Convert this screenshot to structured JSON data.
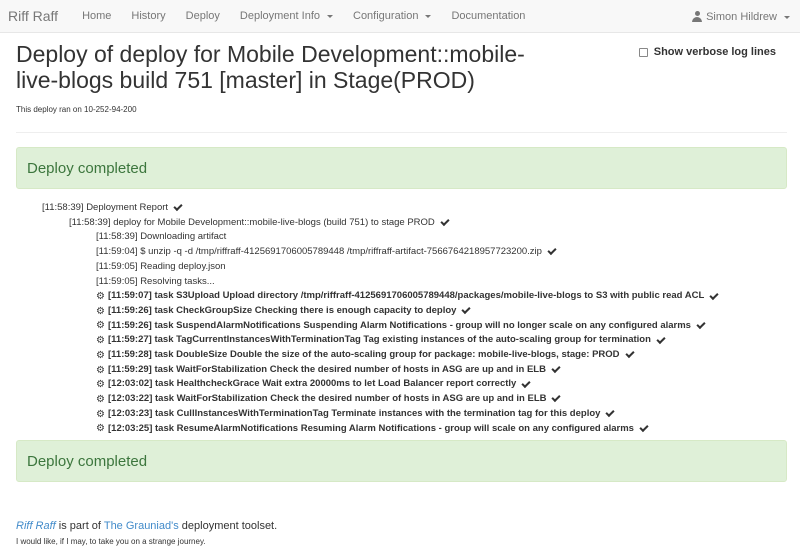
{
  "navbar": {
    "brand": "Riff Raff",
    "items": [
      "Home",
      "History",
      "Deploy",
      "Deployment Info",
      "Configuration",
      "Documentation"
    ],
    "dropdown_items": [
      "Deployment Info",
      "Configuration"
    ],
    "user": "Simon Hildrew"
  },
  "page": {
    "title": "Deploy of deploy for Mobile Development::mobile-live-blogs build 751 [master] in Stage(PROD)",
    "verbose_label": "Show verbose log lines",
    "host_note": "This deploy ran on 10-252-94-200"
  },
  "status": {
    "top": "Deploy completed",
    "bottom": "Deploy completed",
    "color_bg": "#dff0d8",
    "color_text": "#3c763d"
  },
  "log": {
    "report": "[11:58:39] Deployment Report",
    "deploy": "[11:58:39] deploy for Mobile Development::mobile-live-blogs (build 751) to stage PROD",
    "steps": [
      "[11:58:39] Downloading artifact",
      "[11:59:04] $ unzip -q -d /tmp/riffraff-4125691706005789448 /tmp/riffraff-artifact-7566764218957723200.zip",
      "[11:59:05] Reading deploy.json",
      "[11:59:05] Resolving tasks..."
    ],
    "tasks": [
      "[11:59:07] task S3Upload Upload directory /tmp/riffraff-4125691706005789448/packages/mobile-live-blogs to S3 with public read ACL",
      "[11:59:26] task CheckGroupSize Checking there is enough capacity to deploy",
      "[11:59:26] task SuspendAlarmNotifications Suspending Alarm Notifications - group will no longer scale on any configured alarms",
      "[11:59:27] task TagCurrentInstancesWithTerminationTag Tag existing instances of the auto-scaling group for termination",
      "[11:59:28] task DoubleSize Double the size of the auto-scaling group for package: mobile-live-blogs, stage: PROD",
      "[11:59:29] task WaitForStabilization Check the desired number of hosts in ASG are up and in ELB",
      "[12:03:02] task HealthcheckGrace Wait extra 20000ms to let Load Balancer report correctly",
      "[12:03:22] task WaitForStabilization Check the desired number of hosts in ASG are up and in ELB",
      "[12:03:23] task CullInstancesWithTerminationTag Terminate instances with the termination tag for this deploy",
      "[12:03:25] task ResumeAlarmNotifications Resuming Alarm Notifications - group will scale on any configured alarms"
    ]
  },
  "footer": {
    "brand_link": "Riff Raff",
    "text1": "is part of",
    "guardian_link": "The Grauniad's",
    "text2": "deployment toolset.",
    "quote": "I would like, if I may, to take you on a strange journey."
  }
}
